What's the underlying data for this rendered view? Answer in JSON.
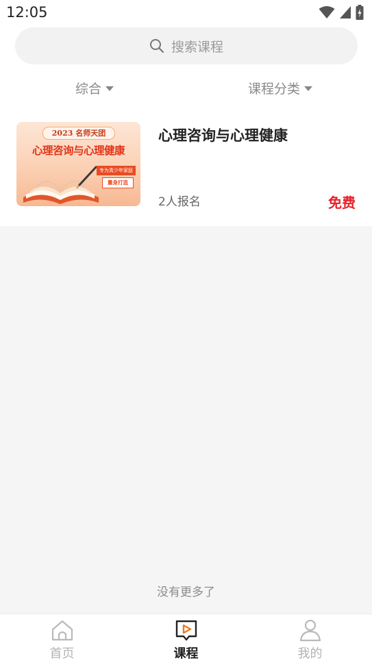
{
  "status_bar": {
    "time": "12:05"
  },
  "search": {
    "placeholder": "搜索课程"
  },
  "filters": [
    {
      "label": "综合"
    },
    {
      "label": "课程分类"
    }
  ],
  "course": {
    "title": "心理咨询与心理健康",
    "enrolled": "2人报名",
    "price": "免费",
    "thumbnail": {
      "year_tag": "2023 名师天团",
      "headline": "心理咨询与心理健康",
      "badge_top": "专为青少年家庭",
      "badge_bottom": "量身打造"
    }
  },
  "footer_text": "没有更多了",
  "tabbar": {
    "items": [
      {
        "label": "首页",
        "icon": "home-icon",
        "active": false
      },
      {
        "label": "课程",
        "icon": "course-play-icon",
        "active": true
      },
      {
        "label": "我的",
        "icon": "profile-icon",
        "active": false
      }
    ]
  },
  "colors": {
    "accent": "#e8202a",
    "thumbnail_red": "#e0361a"
  }
}
